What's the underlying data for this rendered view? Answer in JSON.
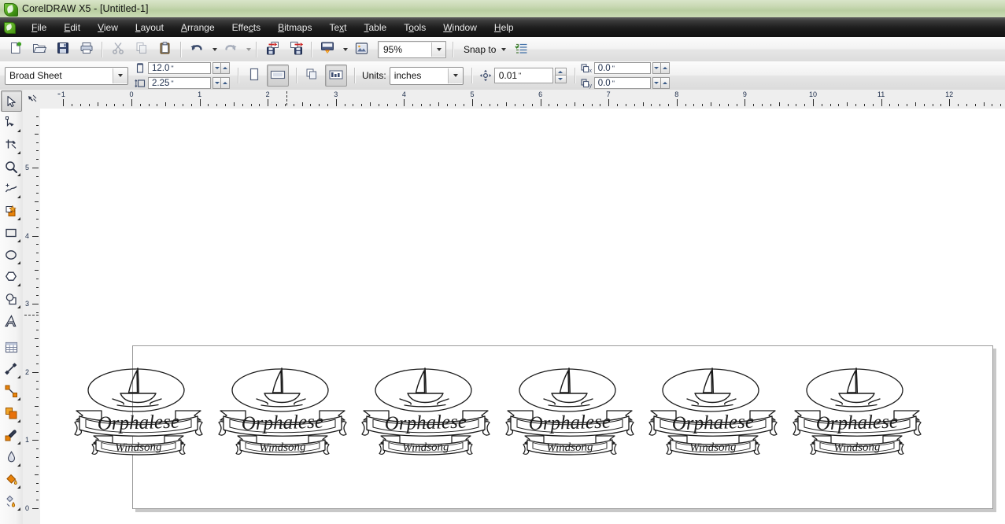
{
  "window": {
    "title": "CorelDRAW X5 - [Untitled-1]",
    "app_icon": "coreldraw-balloon-icon"
  },
  "menu": {
    "items": [
      {
        "label": "File",
        "accel": "F"
      },
      {
        "label": "Edit",
        "accel": "E"
      },
      {
        "label": "View",
        "accel": "V"
      },
      {
        "label": "Layout",
        "accel": "L"
      },
      {
        "label": "Arrange",
        "accel": "A"
      },
      {
        "label": "Effects",
        "accel": "c"
      },
      {
        "label": "Bitmaps",
        "accel": "B"
      },
      {
        "label": "Text",
        "accel": "x"
      },
      {
        "label": "Table",
        "accel": "T"
      },
      {
        "label": "Tools",
        "accel": "o"
      },
      {
        "label": "Window",
        "accel": "W"
      },
      {
        "label": "Help",
        "accel": "H"
      }
    ]
  },
  "standard_toolbar": {
    "buttons": [
      {
        "name": "new-icon",
        "tooltip": "New"
      },
      {
        "name": "open-icon",
        "tooltip": "Open"
      },
      {
        "name": "save-icon",
        "tooltip": "Save"
      },
      {
        "name": "print-icon",
        "tooltip": "Print"
      },
      {
        "name": "cut-icon",
        "tooltip": "Cut"
      },
      {
        "name": "copy-icon",
        "tooltip": "Copy"
      },
      {
        "name": "paste-icon",
        "tooltip": "Paste"
      },
      {
        "name": "undo-icon",
        "tooltip": "Undo"
      },
      {
        "name": "redo-icon",
        "tooltip": "Redo"
      },
      {
        "name": "import-icon",
        "tooltip": "Import"
      },
      {
        "name": "export-icon",
        "tooltip": "Export"
      },
      {
        "name": "publish-pdf-icon",
        "tooltip": "Publish to PDF"
      },
      {
        "name": "app-launcher-icon",
        "tooltip": "Application Launcher"
      }
    ],
    "zoom_level": "95%",
    "snap_to_label": "Snap to",
    "options_icon": "options-icon"
  },
  "property_bar": {
    "paper_type": "Broad Sheet",
    "page_width": "12.0",
    "page_height": "2.25",
    "unit_symbol": "\"",
    "orientation_portrait": "portrait-page-icon",
    "orientation_landscape": "landscape-page-icon",
    "orientation_selected": "landscape",
    "apply_all_pages_icon": "all-pages-icon",
    "apply_current_page_icon": "current-page-icon",
    "apply_scope_selected": "current",
    "units_label": "Units:",
    "units_value": "inches",
    "nudge_offset": "0.01",
    "duplicate_x": "0.0",
    "duplicate_y": "0.0",
    "duplicate_x_label": "x",
    "duplicate_y_label": "y"
  },
  "toolbox": {
    "selected": "pick-tool",
    "tools": [
      {
        "name": "pick-tool",
        "label": "Pick",
        "flyout": false
      },
      {
        "name": "shape-tool",
        "label": "Shape",
        "flyout": true
      },
      {
        "name": "crop-tool",
        "label": "Crop",
        "flyout": true
      },
      {
        "name": "zoom-tool",
        "label": "Zoom",
        "flyout": true
      },
      {
        "name": "freehand-tool",
        "label": "Freehand",
        "flyout": true
      },
      {
        "name": "smart-fill-tool",
        "label": "Smart Fill",
        "flyout": true
      },
      {
        "name": "rectangle-tool",
        "label": "Rectangle",
        "flyout": true
      },
      {
        "name": "ellipse-tool",
        "label": "Ellipse",
        "flyout": true
      },
      {
        "name": "polygon-tool",
        "label": "Polygon",
        "flyout": true
      },
      {
        "name": "basic-shapes-tool",
        "label": "Basic Shapes",
        "flyout": true
      },
      {
        "name": "text-tool",
        "label": "Text",
        "flyout": false
      },
      {
        "name": "table-tool",
        "label": "Table",
        "flyout": false
      },
      {
        "name": "dimension-tool",
        "label": "Dimension",
        "flyout": true
      },
      {
        "name": "connector-tool",
        "label": "Connector",
        "flyout": true
      },
      {
        "name": "blend-tool",
        "label": "Blend",
        "flyout": true
      },
      {
        "name": "color-eyedropper-tool",
        "label": "Color Eyedropper",
        "flyout": true
      },
      {
        "name": "outline-tool",
        "label": "Outline",
        "flyout": true
      },
      {
        "name": "fill-tool",
        "label": "Fill",
        "flyout": true
      },
      {
        "name": "interactive-fill-tool",
        "label": "Interactive Fill",
        "flyout": true
      }
    ]
  },
  "rulers": {
    "horizontal_labels": [
      "1",
      "0",
      "1",
      "2",
      "3",
      "4",
      "5",
      "6",
      "7",
      "8",
      "9",
      "10",
      "11",
      "12"
    ],
    "horizontal_start": -1,
    "horizontal_end": 12,
    "vertical_labels": [
      "5",
      "4",
      "3",
      "2",
      "1",
      "0"
    ],
    "units": "inches"
  },
  "canvas": {
    "page": {
      "width_in": "12.0",
      "height_in": "2.25",
      "orientation": "landscape"
    },
    "logos": {
      "count": 6,
      "top_text": "Orphalese",
      "bottom_text": "Windsong",
      "emblem": "sailboat-in-ellipse"
    }
  },
  "colors": {
    "titlebar_top": "#d9e5c9",
    "titlebar_bottom": "#b9cea1",
    "menubar": "#1c1c1c",
    "menu_text": "#e9e9e9",
    "toolbar_bg": "#f1f1f1",
    "ruler_bg": "#eeeeee",
    "ruler_text": "#20304d",
    "canvas_bg": "#ffffff",
    "page_border": "#9a9a9a",
    "page_shadow": "#c8c8c8",
    "artwork_stroke": "#1a1a1a",
    "accent_green": "#7ac943"
  }
}
